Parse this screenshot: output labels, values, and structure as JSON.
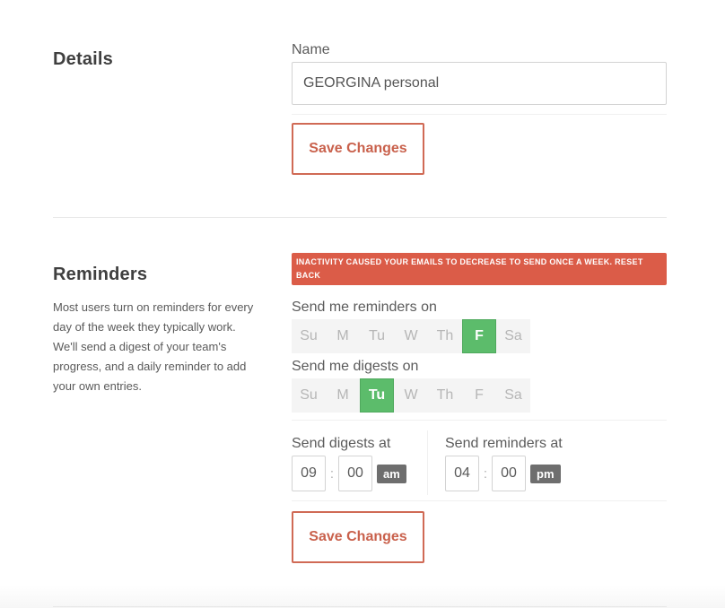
{
  "details": {
    "title": "Details",
    "name_label": "Name",
    "name_value": "GEORGINA personal",
    "save_label": "Save Changes"
  },
  "reminders": {
    "title": "Reminders",
    "description": "Most users turn on reminders for every day of the week they typically work. We'll send a digest of your team's progress, and a daily reminder to add your own entries.",
    "alert": "INACTIVITY CAUSED YOUR EMAILS TO DECREASE TO SEND ONCE A WEEK. RESET BACK",
    "reminder_days_label": "Send me reminders on",
    "digest_days_label": "Send me digests on",
    "days": [
      "Su",
      "M",
      "Tu",
      "W",
      "Th",
      "F",
      "Sa"
    ],
    "reminder_days_selected": [
      "F"
    ],
    "digest_days_selected": [
      "Tu"
    ],
    "digest_time_label": "Send digests at",
    "digest_time": {
      "hour": "09",
      "minute": "00",
      "period": "am"
    },
    "reminder_time_label": "Send reminders at",
    "reminder_time": {
      "hour": "04",
      "minute": "00",
      "period": "pm"
    },
    "save_label": "Save Changes"
  },
  "colors": {
    "accent": "#d06a55",
    "alert_bg": "#db5c48",
    "selected_day": "#5cbc6b",
    "ampm_bg": "#6e6e6e"
  }
}
